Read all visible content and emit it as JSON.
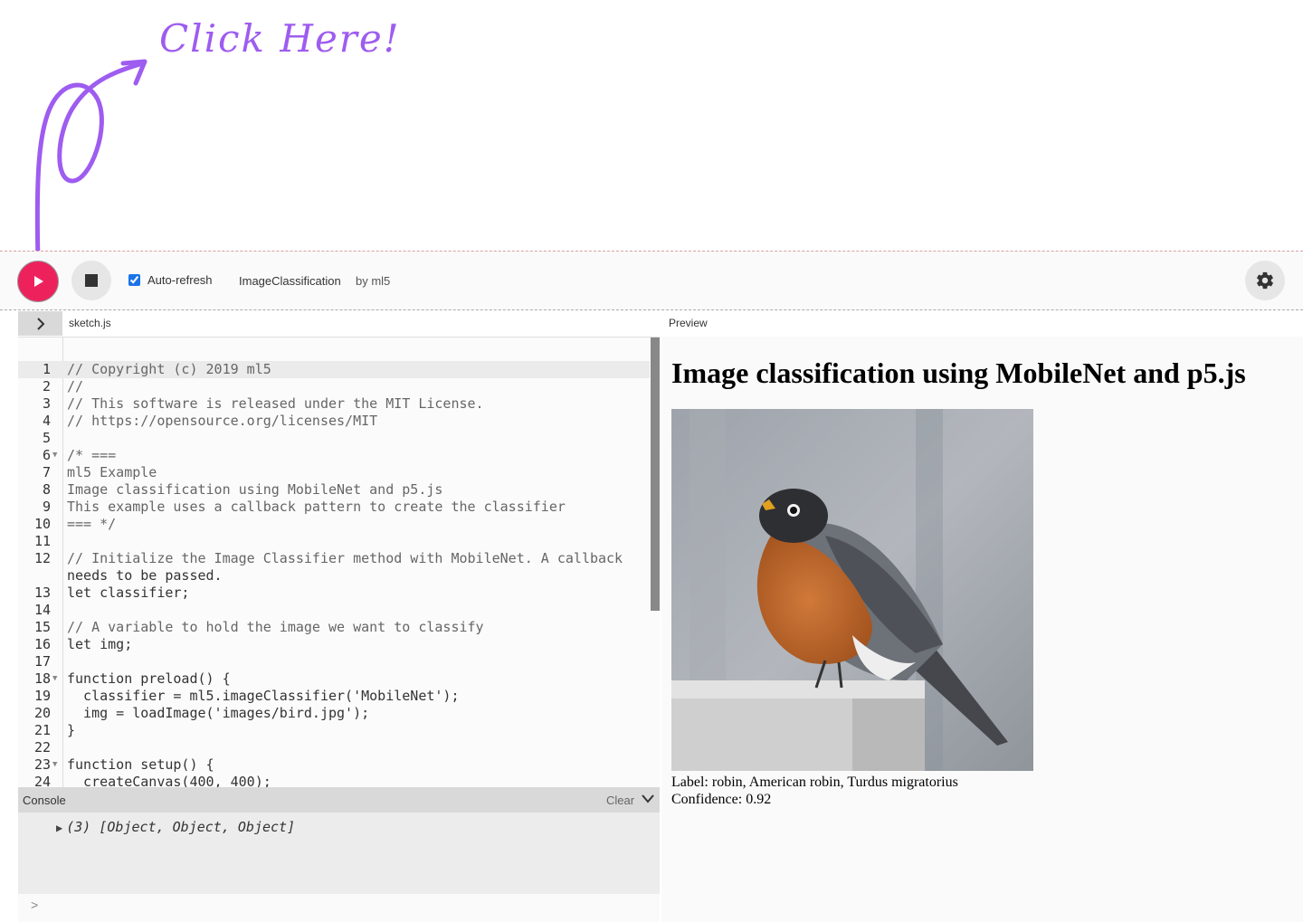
{
  "annotation": {
    "text": "Click Here!",
    "color": "#9e5cf0"
  },
  "toolbar": {
    "play_label": "Play",
    "stop_label": "Stop",
    "auto_refresh_label": "Auto-refresh",
    "auto_refresh_checked": true,
    "project_name": "ImageClassification",
    "project_author": "by ml5",
    "settings_icon": "gear-icon",
    "play_color": "#ed225d"
  },
  "editor": {
    "file_name": "sketch.js",
    "lines": [
      {
        "n": "1",
        "text": "// Copyright (c) 2019 ml5"
      },
      {
        "n": "2",
        "text": "//"
      },
      {
        "n": "3",
        "text": "// This software is released under the MIT License."
      },
      {
        "n": "4",
        "text": "// https://opensource.org/licenses/MIT"
      },
      {
        "n": "5",
        "text": ""
      },
      {
        "n": "6",
        "text": "/* ==="
      },
      {
        "n": "7",
        "text": "ml5 Example"
      },
      {
        "n": "8",
        "text": "Image classification using MobileNet and p5.js"
      },
      {
        "n": "9",
        "text": "This example uses a callback pattern to create the classifier"
      },
      {
        "n": "10",
        "text": "=== */"
      },
      {
        "n": "11",
        "text": ""
      },
      {
        "n": "12",
        "text": "// Initialize the Image Classifier method with MobileNet. A callback"
      },
      {
        "n": "",
        "text": "needs to be passed."
      },
      {
        "n": "13",
        "text": "let classifier;"
      },
      {
        "n": "14",
        "text": ""
      },
      {
        "n": "15",
        "text": "// A variable to hold the image we want to classify"
      },
      {
        "n": "16",
        "text": "let img;"
      },
      {
        "n": "17",
        "text": ""
      },
      {
        "n": "18",
        "text": "function preload() {"
      },
      {
        "n": "19",
        "text": "  classifier = ml5.imageClassifier('MobileNet');"
      },
      {
        "n": "20",
        "text": "  img = loadImage('images/bird.jpg');"
      },
      {
        "n": "21",
        "text": "}"
      },
      {
        "n": "22",
        "text": ""
      },
      {
        "n": "23",
        "text": "function setup() {"
      },
      {
        "n": "24",
        "text": "  createCanvas(400, 400);"
      }
    ]
  },
  "console": {
    "title": "Console",
    "clear_label": "Clear",
    "entry": "(3) [Object, Object, Object]",
    "prompt": ">"
  },
  "preview": {
    "label": "Preview",
    "title": "Image classification using MobileNet and p5.js",
    "result_label": "Label: robin, American robin, Turdus migratorius",
    "result_confidence": "Confidence: 0.92"
  }
}
